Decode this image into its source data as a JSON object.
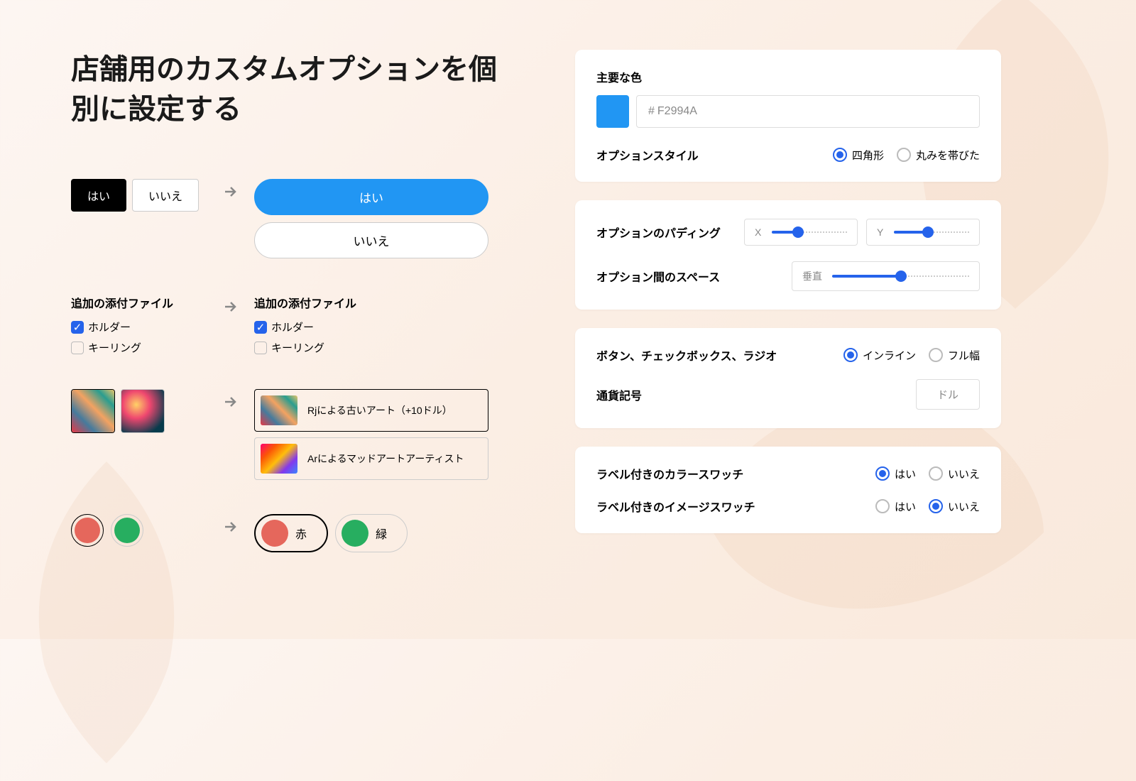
{
  "heading": "店舗用のカスタムオプションを個別に設定する",
  "examples": {
    "yesno": {
      "yes": "はい",
      "no": "いいえ"
    },
    "attachments": {
      "title": "追加の添付ファイル",
      "holder": "ホルダー",
      "keyring": "キーリング"
    },
    "imageOptions": {
      "opt1": "Rjによる古いアート（+10ドル）",
      "opt2": "Arによるマッドアートアーティスト"
    },
    "colors": {
      "red": "赤",
      "green": "緑"
    }
  },
  "settings": {
    "primaryColor": {
      "label": "主要な色",
      "hash": "#",
      "value": "F2994A",
      "swatch": "#2196f3"
    },
    "optionStyle": {
      "label": "オプションスタイル",
      "square": "四角形",
      "rounded": "丸みを帯びた",
      "selected": "square"
    },
    "padding": {
      "label": "オプションのパディング",
      "x": "X",
      "y": "Y",
      "xVal": 35,
      "yVal": 45
    },
    "spacing": {
      "label": "オプション間のスペース",
      "vertical": "垂直",
      "val": 50
    },
    "buttonLayout": {
      "label": "ボタン、チェックボックス、ラジオ",
      "inline": "インライン",
      "full": "フル幅",
      "selected": "inline"
    },
    "currency": {
      "label": "通貨記号",
      "value": "ドル"
    },
    "colorSwatchLabel": {
      "label": "ラベル付きのカラースワッチ",
      "yes": "はい",
      "no": "いいえ",
      "selected": "yes"
    },
    "imageSwatchLabel": {
      "label": "ラベル付きのイメージスワッチ",
      "yes": "はい",
      "no": "いいえ",
      "selected": "no"
    }
  }
}
